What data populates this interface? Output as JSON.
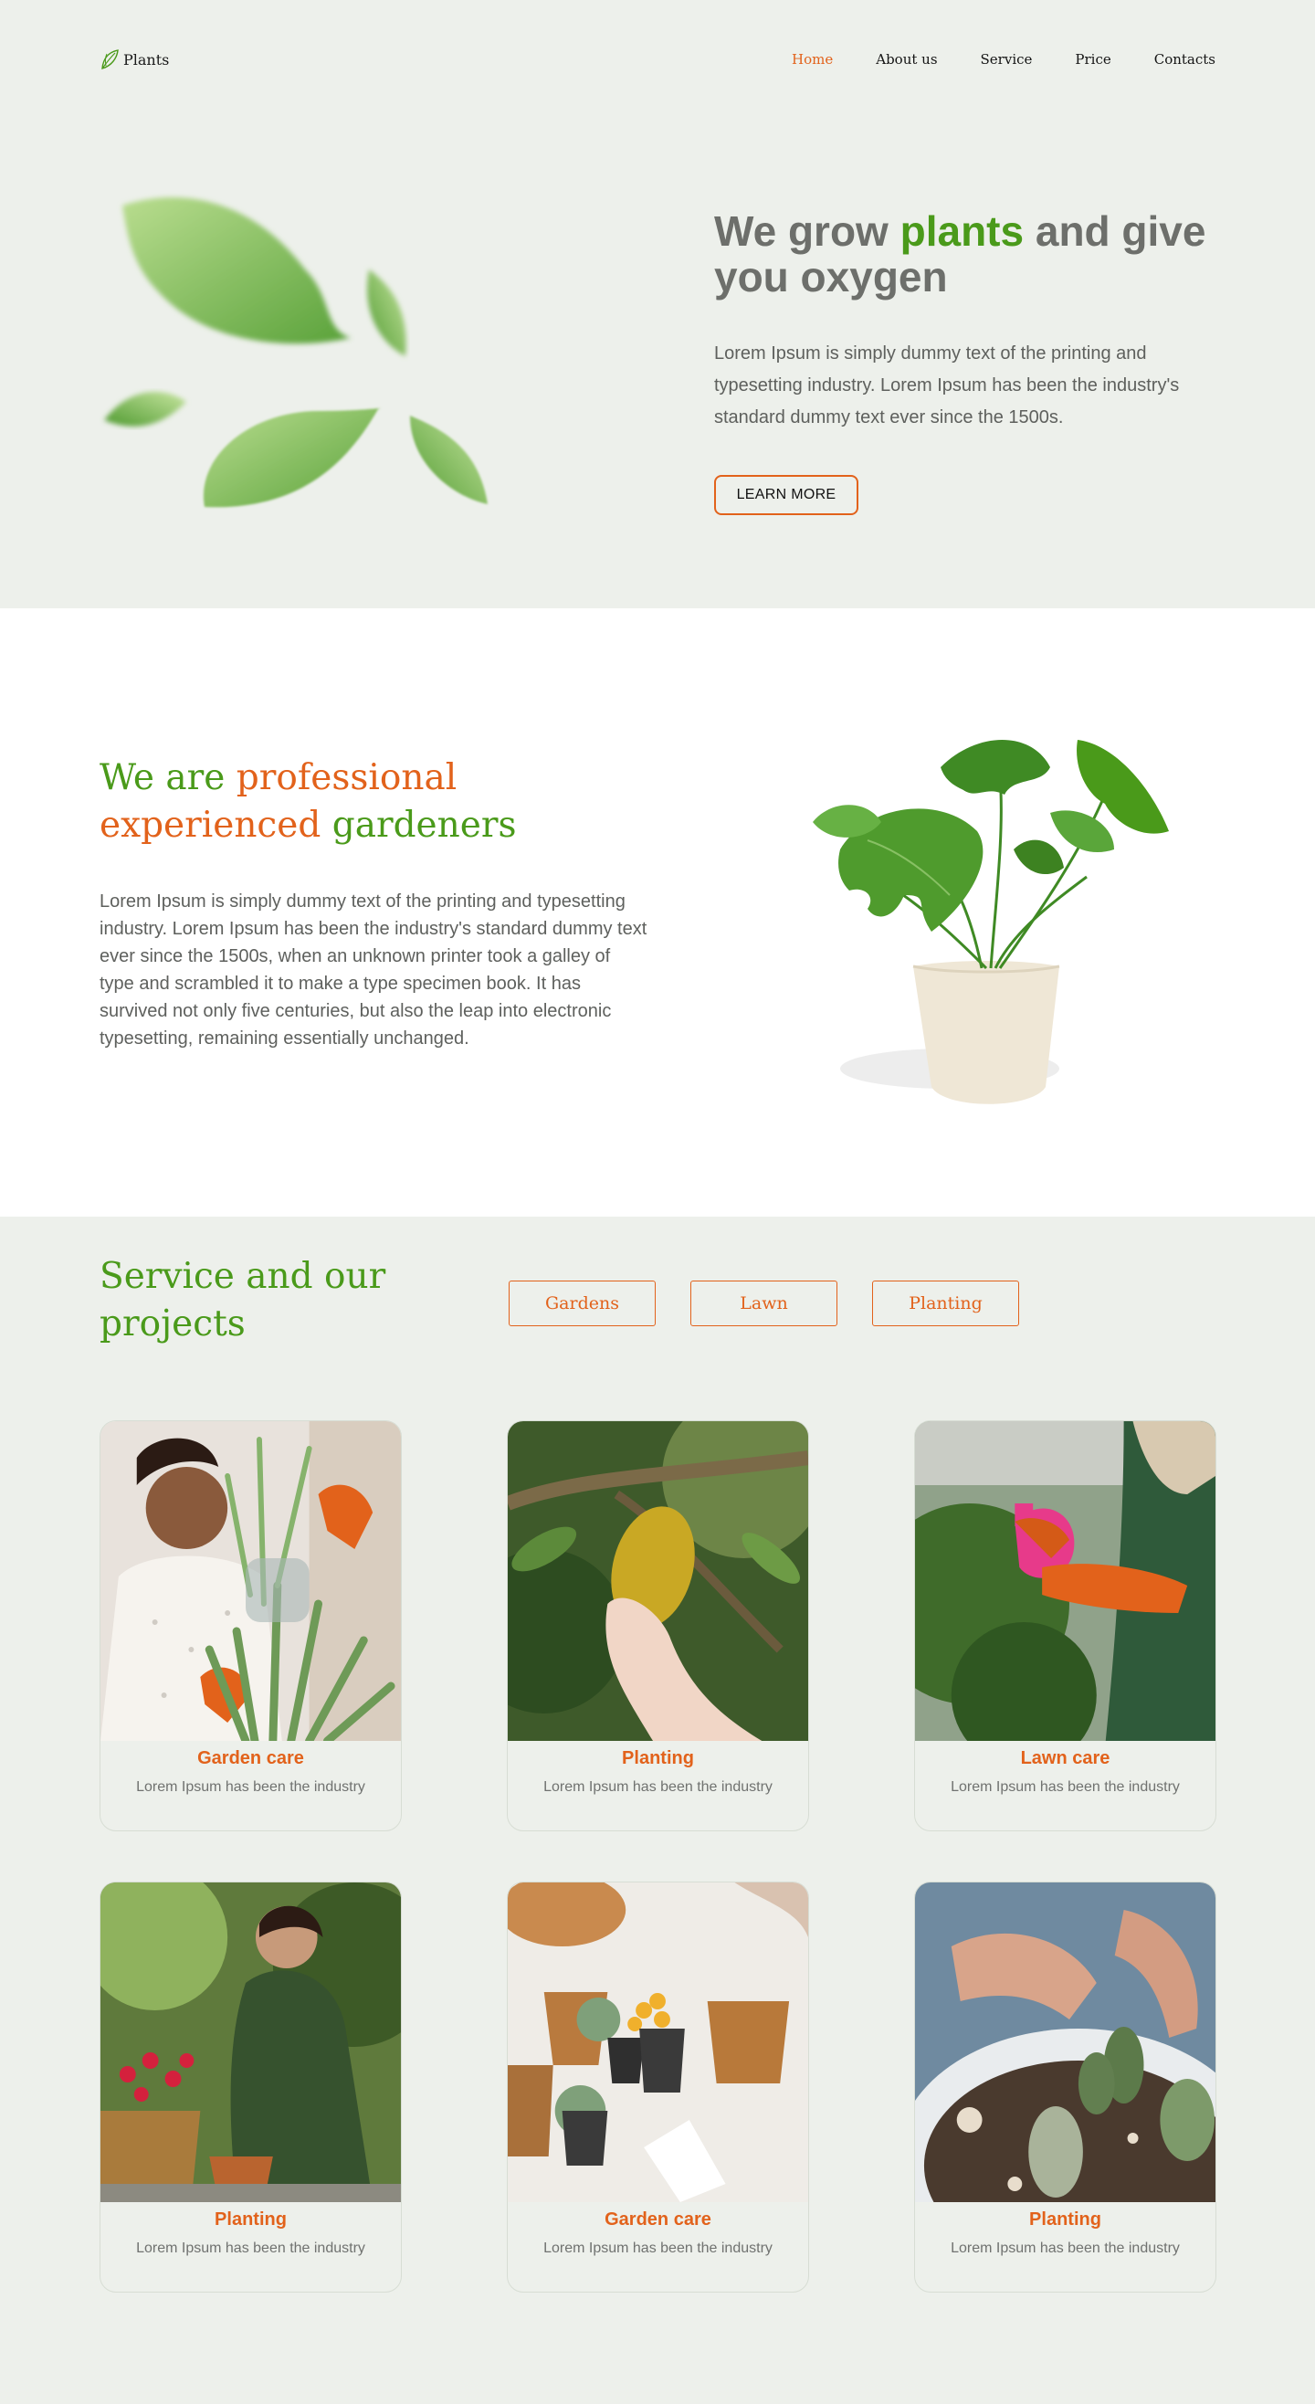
{
  "brand": {
    "name": "Plants",
    "logo_icon": "leaf-logo-icon"
  },
  "nav": {
    "items": [
      {
        "label": "Home",
        "active": true
      },
      {
        "label": "About us",
        "active": false
      },
      {
        "label": "Service",
        "active": false
      },
      {
        "label": "Price",
        "active": false
      },
      {
        "label": "Contacts",
        "active": false
      }
    ]
  },
  "hero": {
    "title_part1": "We grow ",
    "title_highlight": "plants",
    "title_part2": " and give you oxygen",
    "text": "Lorem Ipsum is simply dummy text of the printing and typesetting industry. Lorem Ipsum has been the industry's standard dummy text ever since the 1500s.",
    "button_label": "LEARN MORE"
  },
  "about": {
    "title_part1": "We are ",
    "title_orange": "professional experienced",
    "title_part2": " gardeners",
    "text": "Lorem Ipsum is simply dummy text of the printing and typesetting industry. Lorem Ipsum has been the industry's standard dummy text ever since the 1500s, when an unknown printer took a galley of type and scrambled it to make a type specimen book. It has survived not only five centuries, but also the leap into electronic typesetting, remaining essentially unchanged."
  },
  "services": {
    "title": "Service and our projects",
    "filters": [
      "Gardens",
      "Lawn",
      "Planting"
    ],
    "cards": [
      {
        "title": "Garden care",
        "subtitle": "Lorem Ipsum has been the industry"
      },
      {
        "title": "Planting",
        "subtitle": "Lorem Ipsum has been the industry"
      },
      {
        "title": "Lawn care",
        "subtitle": "Lorem Ipsum has been the industry"
      },
      {
        "title": "Planting",
        "subtitle": "Lorem Ipsum has been the industry"
      },
      {
        "title": "Garden care",
        "subtitle": "Lorem Ipsum has been the industry"
      },
      {
        "title": "Planting",
        "subtitle": "Lorem Ipsum has been the industry"
      }
    ]
  },
  "colors": {
    "accent_orange": "#e2621b",
    "accent_green": "#4a9a1a",
    "background": "#edf0eb",
    "text_muted": "#5e605d"
  }
}
